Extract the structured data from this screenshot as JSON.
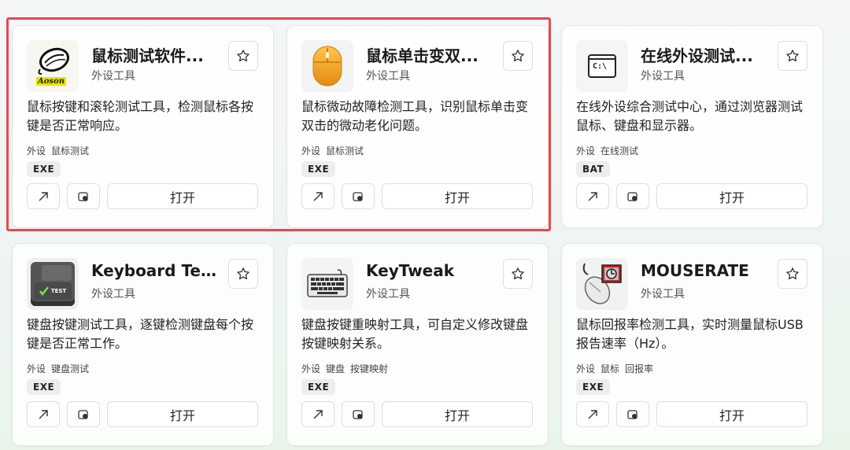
{
  "open_label": "打开",
  "cards": [
    {
      "title": "鼠标测试软件...",
      "category": "外设工具",
      "description": "鼠标按键和滚轮测试工具，检测鼠标各按键是否正常响应。",
      "tags": [
        "外设",
        "鼠标测试"
      ],
      "badge": "EXE",
      "icon": "mouse-logo-icon",
      "icon_text": "Aoson"
    },
    {
      "title": "鼠标单击变双...",
      "category": "外设工具",
      "description": "鼠标微动故障检测工具，识别鼠标单击变双击的微动老化问题。",
      "tags": [
        "外设",
        "鼠标测试"
      ],
      "badge": "EXE",
      "icon": "orange-mouse-icon"
    },
    {
      "title": "在线外设测试...",
      "category": "外设工具",
      "description": "在线外设综合测试中心，通过浏览器测试鼠标、键盘和显示器。",
      "tags": [
        "外设",
        "在线测试"
      ],
      "badge": "BAT",
      "icon": "terminal-icon",
      "icon_text": "C:\\"
    },
    {
      "title": "Keyboard Tes...",
      "category": "外设工具",
      "description": "键盘按键测试工具，逐键检测键盘每个按键是否正常工作。",
      "tags": [
        "外设",
        "键盘测试"
      ],
      "badge": "EXE",
      "icon": "keyboard-test-icon",
      "icon_text": "TEST"
    },
    {
      "title": "KeyTweak",
      "category": "外设工具",
      "description": "键盘按键重映射工具，可自定义修改键盘按键映射关系。",
      "tags": [
        "外设",
        "键盘",
        "按键映射"
      ],
      "badge": "EXE",
      "icon": "keyboard-icon"
    },
    {
      "title": "MOUSERATE",
      "category": "外设工具",
      "description": "鼠标回报率检测工具，实时测量鼠标USB 报告速率（Hz）。",
      "tags": [
        "外设",
        "鼠标",
        "回报率"
      ],
      "badge": "EXE",
      "icon": "mouse-rate-icon"
    }
  ],
  "colors": {
    "highlight": "#e8484e",
    "badge_bg": "#eceeed",
    "mouse_orange": "#f0a020"
  }
}
